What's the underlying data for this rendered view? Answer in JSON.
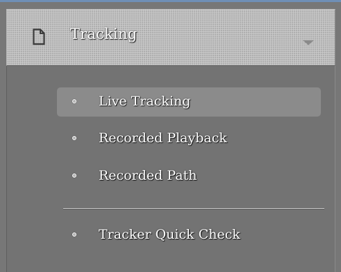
{
  "header": {
    "title": "Tracking",
    "icon": "page-icon",
    "expand_icon": "chevron-down-icon"
  },
  "menu": {
    "items": [
      {
        "label": "Live Tracking",
        "active": true,
        "icon": "bullet-icon"
      },
      {
        "label": "Recorded Playback",
        "active": false,
        "icon": "bullet-icon"
      },
      {
        "label": "Recorded Path",
        "active": false,
        "icon": "bullet-icon"
      },
      {
        "label": "Tracker Quick Check",
        "active": false,
        "icon": "bullet-icon"
      }
    ]
  },
  "colors": {
    "panel_background": "#777777",
    "header_background": "#bdbdbd",
    "active_item_background": "#8b8b8b",
    "text": "#ffffff",
    "top_border_accent": "#6f8fb6"
  }
}
